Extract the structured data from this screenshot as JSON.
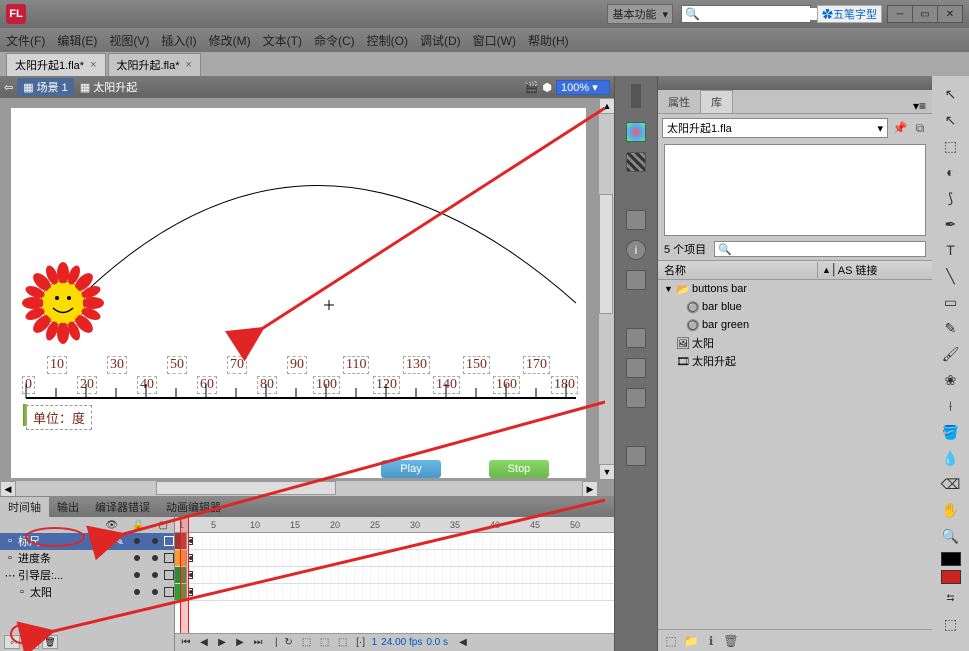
{
  "titlebar": {
    "logo": "FL",
    "workspace": "基本功能",
    "ime": "五笔字型",
    "search_placeholder": ""
  },
  "menu": {
    "file": "文件(F)",
    "edit": "编辑(E)",
    "view": "视图(V)",
    "insert": "插入(I)",
    "modify": "修改(M)",
    "text": "文本(T)",
    "commands": "命令(C)",
    "control": "控制(O)",
    "debug": "调试(D)",
    "window": "窗口(W)",
    "help": "帮助(H)"
  },
  "doctabs": [
    {
      "label": "太阳升起1.fla*"
    },
    {
      "label": "太阳升起.fla*"
    }
  ],
  "scene": {
    "scene_name": "场景 1",
    "clip_name": "太阳升起",
    "zoom": "100%"
  },
  "stage": {
    "ruler_top": [
      "10",
      "30",
      "50",
      "70",
      "90",
      "110",
      "130",
      "150",
      "170"
    ],
    "ruler_bot": [
      "0",
      "20",
      "40",
      "60",
      "80",
      "100",
      "120",
      "140",
      "160",
      "180"
    ],
    "ruler_unit": "单位：度",
    "play": "Play",
    "stop": "Stop"
  },
  "timeline": {
    "tabs": {
      "tl": "时间轴",
      "out": "输出",
      "err": "编译器错误",
      "anim": "动画编辑器"
    },
    "ruler": [
      "1",
      "5",
      "10",
      "15",
      "20",
      "25",
      "30",
      "35",
      "40",
      "45",
      "50"
    ],
    "layers": [
      {
        "name": "标尺",
        "color": "#aa3030",
        "active": true,
        "icon": "page"
      },
      {
        "name": "进度条",
        "color": "#ff9a2a",
        "active": false,
        "icon": "page"
      },
      {
        "name": "引导层:...",
        "color": "#308a30",
        "active": false,
        "icon": "guide"
      },
      {
        "name": "太阳",
        "color": "#30a030",
        "active": false,
        "icon": "page"
      }
    ],
    "status": {
      "frame": "1",
      "fps": "24.00 fps",
      "time": "0.0 s"
    }
  },
  "library": {
    "tabs": {
      "prop": "属性",
      "lib": "库"
    },
    "doc": "太阳升起1.fla",
    "count": "5 个项目",
    "cols": {
      "name": "名称",
      "link": "AS 链接"
    },
    "items": [
      {
        "label": "buttons bar",
        "type": "folder",
        "indent": 0,
        "expanded": true
      },
      {
        "label": "bar blue",
        "type": "button",
        "indent": 1
      },
      {
        "label": "bar green",
        "type": "button",
        "indent": 1
      },
      {
        "label": "太阳",
        "type": "graphic",
        "indent": 0
      },
      {
        "label": "太阳升起",
        "type": "movieclip",
        "indent": 0
      }
    ]
  },
  "chart_data": {
    "type": "other",
    "note": "Ruler graphic on stage spans 0–180 degrees with major ticks every 20 and minor every 10; arc path shown above ruler with sun at left end.",
    "range": [
      0,
      180
    ],
    "unit": "度"
  }
}
